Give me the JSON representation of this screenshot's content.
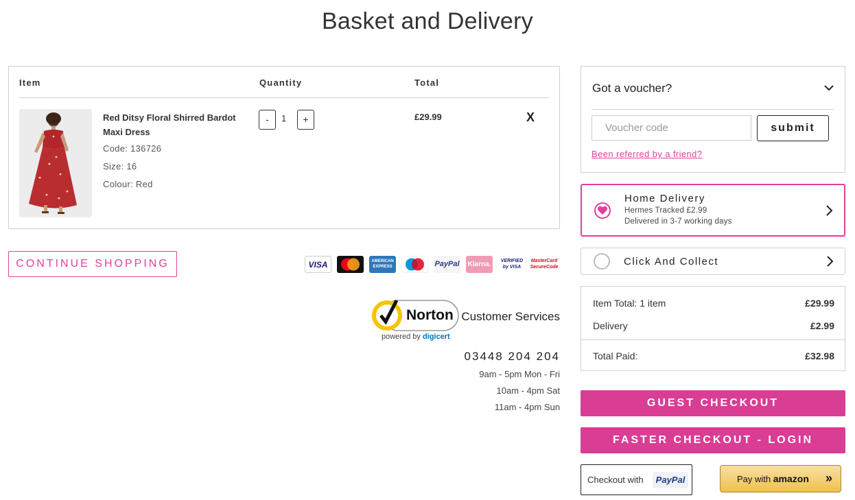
{
  "page": {
    "title": "Basket and Delivery"
  },
  "basket": {
    "headers": {
      "item": "Item",
      "quantity": "Quantity",
      "total": "Total"
    },
    "items": [
      {
        "name": "Red Ditsy Floral Shirred Bardot Maxi Dress",
        "code": "Code: 136726",
        "size": "Size: 16",
        "colour": "Colour: Red",
        "quantity": "1",
        "total": "£29.99",
        "decrease_label": "-",
        "increase_label": "+",
        "remove_label": "X"
      }
    ],
    "continue_label": "CONTINUE SHOPPING"
  },
  "payment_icons": [
    {
      "name": "visa-icon",
      "label": "VISA"
    },
    {
      "name": "mastercard-icon",
      "label": "MasterCard"
    },
    {
      "name": "amex-icon",
      "label": "AMERICAN EXPRESS"
    },
    {
      "name": "maestro-icon",
      "label": "Maestro"
    },
    {
      "name": "paypal-icon",
      "label": "PayPal"
    },
    {
      "name": "klarna-icon",
      "label": "Klarna."
    },
    {
      "name": "verified-by-visa-icon",
      "label": "VERIFIED by VISA"
    },
    {
      "name": "mastercard-securecode-icon",
      "label": "MasterCard SecureCode"
    }
  ],
  "norton": {
    "brand": "Norton",
    "sub": "powered by",
    "sub_brand": "digicert"
  },
  "customer_services": {
    "label": "Customer Services",
    "phone": "03448 204 204",
    "hours": [
      "9am - 5pm Mon - Fri",
      "10am - 4pm Sat",
      "11am - 4pm Sun"
    ]
  },
  "voucher": {
    "title": "Got a voucher?",
    "placeholder": "Voucher code",
    "submit_label": "submit",
    "referral_link": "Been referred by a friend?"
  },
  "delivery": {
    "home": {
      "title": "Home Delivery",
      "subtitle": "Hermes Tracked  £2.99",
      "detail": "Delivered in 3-7 working days",
      "selected": true
    },
    "collect": {
      "title": "Click And Collect",
      "selected": false
    }
  },
  "summary": {
    "item_total_label": "Item Total: 1 item",
    "item_total_value": "£29.99",
    "delivery_label": "Delivery",
    "delivery_value": "£2.99",
    "total_label": "Total Paid:",
    "total_value": "£32.98"
  },
  "checkout": {
    "guest_label": "GUEST CHECKOUT",
    "login_label": "FASTER CHECKOUT - LOGIN",
    "paypal_label": "Checkout with",
    "paypal_brand": "PayPal",
    "amazon_label": "Pay with ",
    "amazon_brand": "amazon",
    "amazon_arrows": "»"
  },
  "colors": {
    "accent": "#e0409c",
    "button_pink": "#d93d94",
    "amazon_gold": "#f0c14b"
  }
}
